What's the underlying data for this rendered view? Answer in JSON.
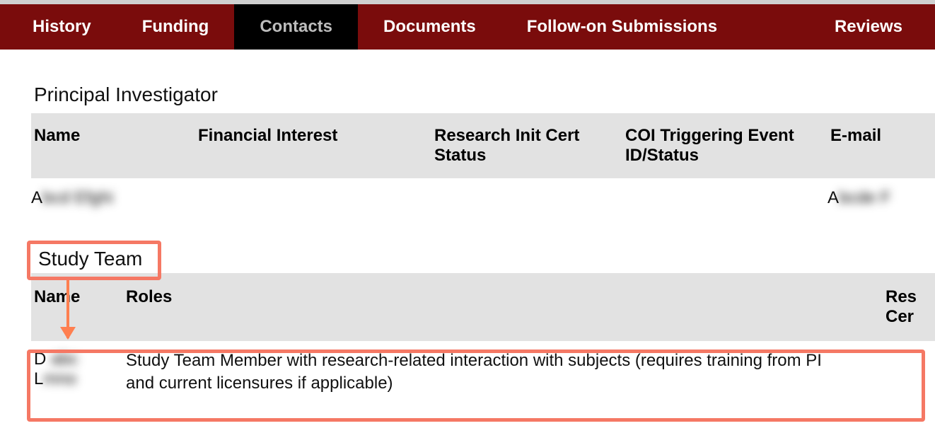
{
  "tabs": {
    "history": "History",
    "funding": "Funding",
    "contacts": "Contacts",
    "documents": "Documents",
    "follow_on": "Follow-on Submissions",
    "reviews": "Reviews",
    "active": "contacts"
  },
  "pi_section": {
    "title": "Principal Investigator",
    "headers": {
      "name": "Name",
      "financial_interest": "Financial Interest",
      "cert_status": "Research Init Cert Status",
      "coi": "COI Triggering Event ID/Status",
      "email": "E-mail"
    },
    "rows": [
      {
        "name_display": "A███ █████",
        "financial_interest": "",
        "cert_status": "",
        "coi": "",
        "email_display": "A████ █"
      }
    ]
  },
  "study_team": {
    "title": "Study Team",
    "headers": {
      "name": "Name",
      "roles": "Roles",
      "rest_line1": "Res",
      "rest_line2": "Cer"
    },
    "rows": [
      {
        "name_line1": "D ███",
        "name_line2": "L███",
        "roles": "Study Team Member with research-related interaction with subjects (requires training from PI and current licensures if applicable)"
      }
    ]
  }
}
